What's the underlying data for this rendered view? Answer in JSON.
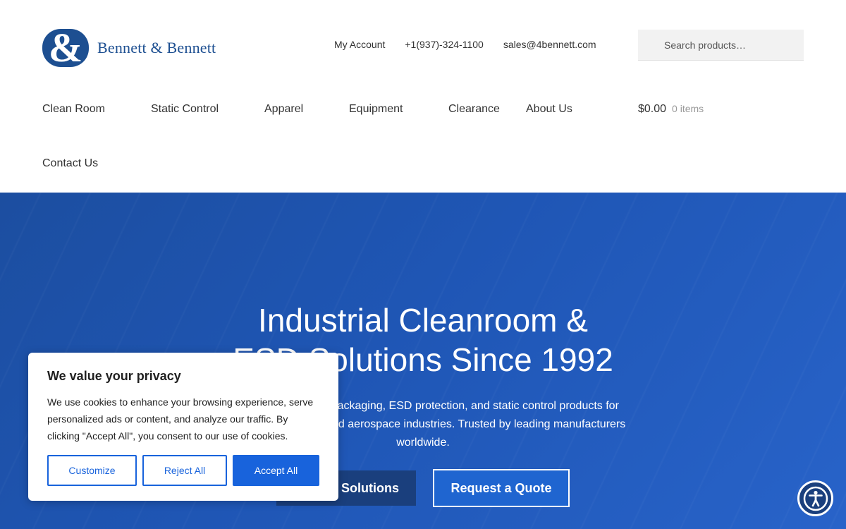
{
  "brand": {
    "logo_mark": "&",
    "name": "Bennett & Bennett",
    "color": "#1d4f91"
  },
  "top_links": {
    "account": "My Account",
    "phone": "+1(937)-324-1100",
    "email": "sales@4bennett.com"
  },
  "search": {
    "placeholder": "Search products…"
  },
  "nav": {
    "items": [
      "Clean Room",
      "Static Control",
      "Apparel",
      "Equipment",
      "Clearance",
      "About Us",
      "Contact Us"
    ]
  },
  "cart": {
    "total": "$0.00",
    "items": "0 items"
  },
  "hero": {
    "title_line1": "Industrial Cleanroom &",
    "title_line2": "ESD Solutions Since 1992",
    "subtitle": "Premium cleanroom packaging, ESD protection, and static control products for electronics, medical, and aerospace industries. Trusted by leading manufacturers worldwide.",
    "primary_button": "Explore Solutions",
    "secondary_button": "Request a Quote",
    "background_color": "#1f56b5"
  },
  "cookie": {
    "title": "We value your privacy",
    "body": "We use cookies to enhance your browsing experience, serve personalized ads or content, and analyze our traffic. By clicking \"Accept All\", you consent to our use of cookies.",
    "customize": "Customize",
    "reject": "Reject All",
    "accept": "Accept All",
    "accent_color": "#1863dc"
  },
  "accessibility": {
    "icon": "accessibility-icon"
  }
}
